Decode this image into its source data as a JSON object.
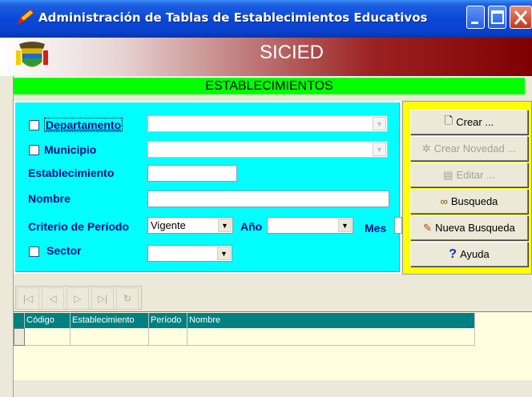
{
  "window": {
    "title": "Administración de Tablas de Establecimientos Educativos",
    "title_icon": "pencil-app-icon"
  },
  "header": {
    "app_title": "SICIED",
    "logo": "colombia-coat-of-arms"
  },
  "section": {
    "title": "ESTABLECIMIENTOS"
  },
  "filters": {
    "departamento_label": "Departamento",
    "municipio_label": "Municipio",
    "establecimiento_label": "Establecimiento",
    "nombre_label": "Nombre",
    "criterio_label": "Criterio de Período",
    "criterio_value": "Vigente",
    "anio_label": "Año",
    "anio_value": "",
    "mes_label": "Mes",
    "sector_label": "Sector",
    "sector_value": ""
  },
  "actions": {
    "crear": "Crear ...",
    "crear_novedad": "Crear Novedad ...",
    "editar": "Editar ...",
    "busqueda": "Busqueda",
    "nueva_busqueda": "Nueva Busqueda",
    "ayuda": "Ayuda"
  },
  "navigator": {
    "buttons": [
      "first",
      "prior",
      "next",
      "last",
      "refresh"
    ]
  },
  "grid": {
    "columns": [
      "Código",
      "Establecimiento",
      "Período",
      "Nombre"
    ]
  },
  "colors": {
    "section_bar": "#00ff00",
    "filter_panel": "#00ffff",
    "button_panel": "#ffff00",
    "grid_header": "#008080",
    "banner_dark": "#7f0000"
  }
}
